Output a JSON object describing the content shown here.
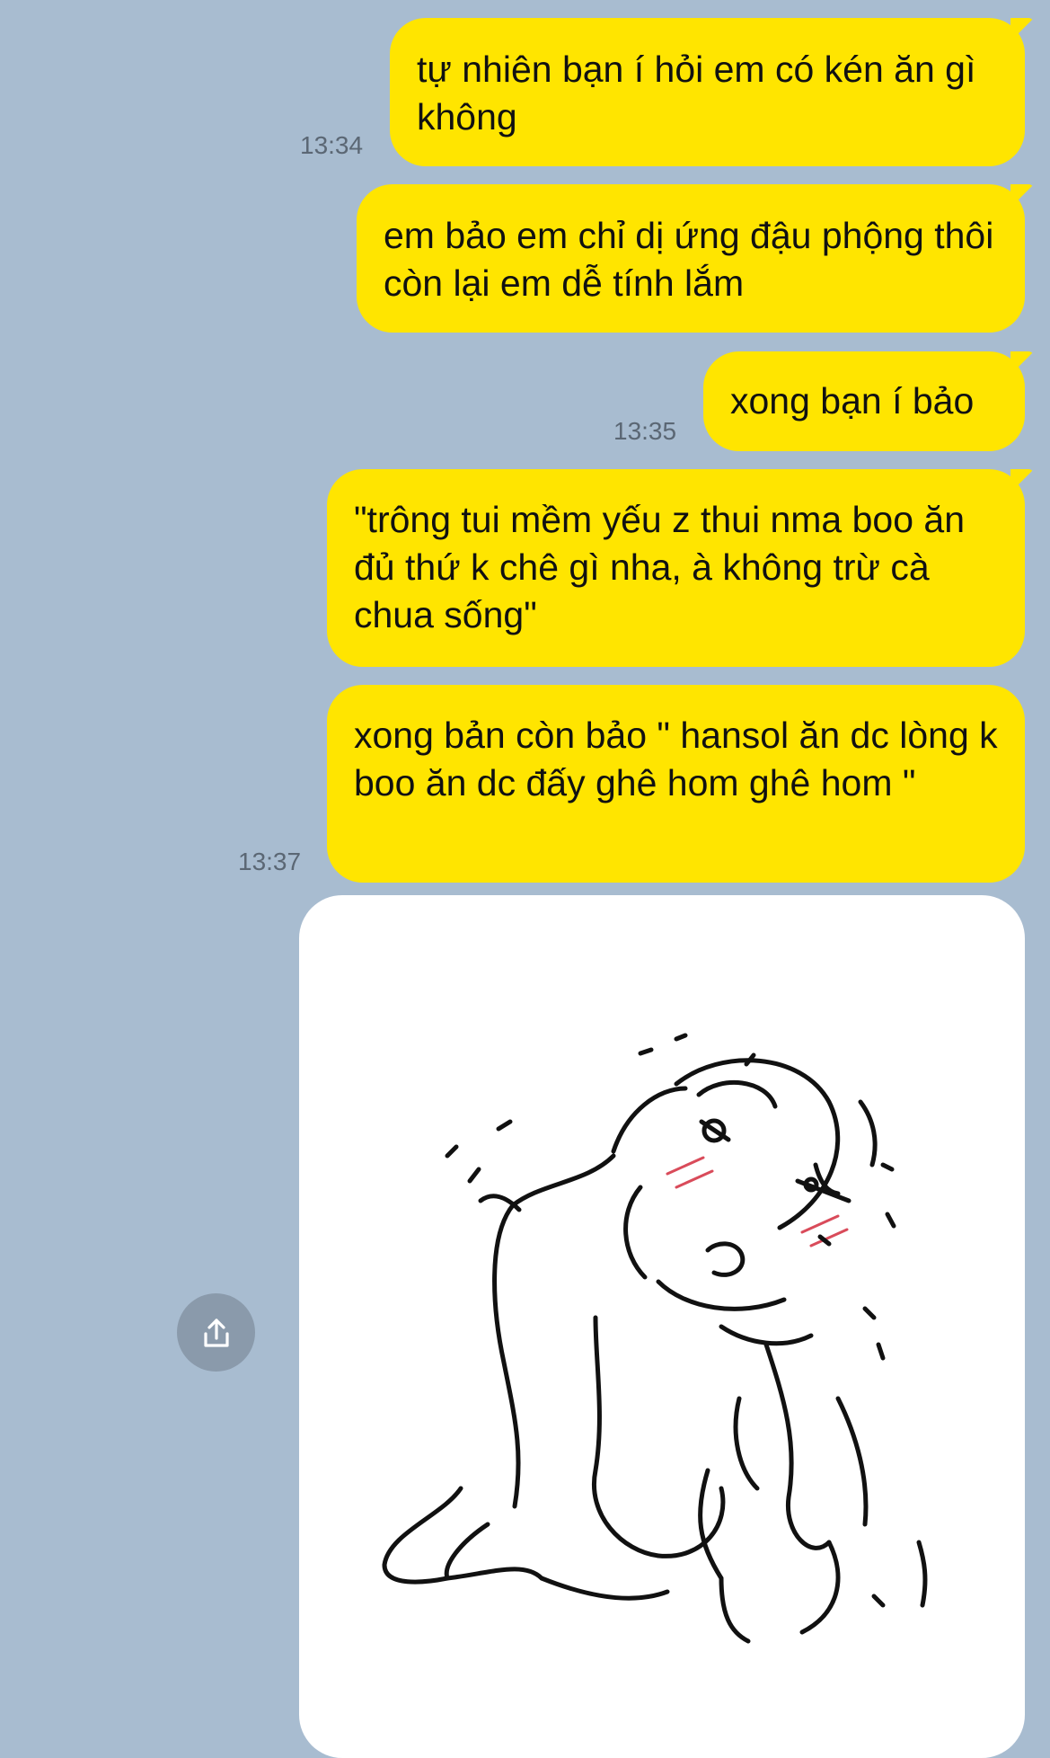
{
  "chat": {
    "messages": [
      {
        "text": "tự nhiên bạn í hỏi em có kén ăn gì không",
        "time": "13:34"
      },
      {
        "text": "em bảo em chỉ dị ứng đậu phộng thôi còn lại em dễ tính lắm",
        "time": ""
      },
      {
        "text": "xong bạn í bảo",
        "time": "13:35"
      },
      {
        "text": "\"trông tui mềm yếu z thui nma boo ăn đủ thứ k chê gì nha, à không trừ cà chua sống\"",
        "time": ""
      },
      {
        "text": "xong bản còn bảo \" hansol ăn dc lòng k boo ăn dc đấy ghê hom ghê hom \"",
        "time": "13:37"
      }
    ],
    "image_message": {
      "description": "hand-drawn sketch sticker"
    },
    "share_button_icon": "share-icon"
  },
  "colors": {
    "background": "#a8bcd0",
    "bubble": "#ffe500",
    "timestamp": "#5b6774",
    "share_button": "#8a9aab"
  }
}
